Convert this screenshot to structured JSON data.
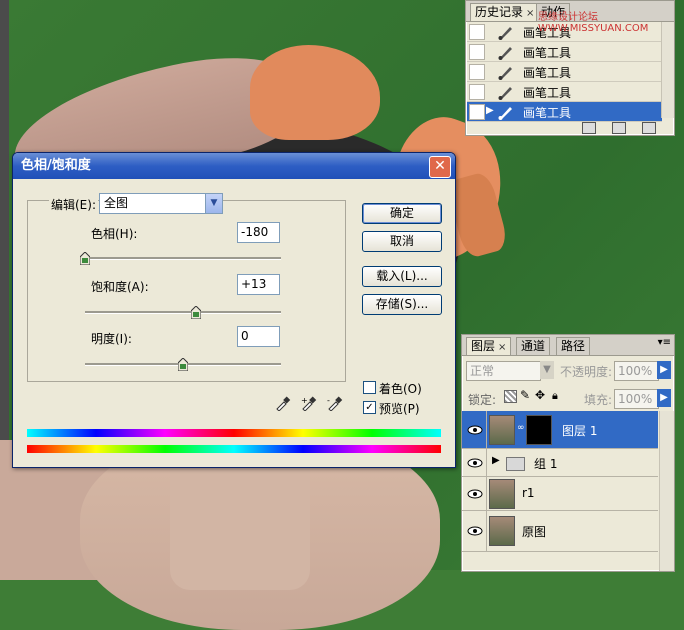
{
  "history": {
    "tabs": [
      "历史记录",
      "动作"
    ],
    "watermark": "思缘设计论坛 WWW.MISSYUAN.COM",
    "items": [
      {
        "label": "画笔工具",
        "selected": false
      },
      {
        "label": "画笔工具",
        "selected": false
      },
      {
        "label": "画笔工具",
        "selected": false
      },
      {
        "label": "画笔工具",
        "selected": false
      },
      {
        "label": "画笔工具",
        "selected": true
      }
    ]
  },
  "dialog": {
    "title": "色相/饱和度",
    "edit_label": "编辑(E):",
    "edit_value": "全图",
    "hue_label": "色相(H):",
    "hue_value": "-180",
    "sat_label": "饱和度(A):",
    "sat_value": "+13",
    "light_label": "明度(I):",
    "light_value": "0",
    "ok": "确定",
    "cancel": "取消",
    "load": "载入(L)...",
    "save": "存储(S)...",
    "colorize_label": "着色(O)",
    "colorize_checked": false,
    "preview_label": "预览(P)",
    "preview_checked": true,
    "hue_fraction": 0.0,
    "sat_fraction": 0.565,
    "light_fraction": 0.5,
    "close_glyph": "✕"
  },
  "layers": {
    "tabs": [
      "图层",
      "通道",
      "路径"
    ],
    "blend_mode": "正常",
    "opacity_label": "不透明度:",
    "opacity_value": "100%",
    "lock_label": "锁定:",
    "fill_label": "填充:",
    "fill_value": "100%",
    "rows": [
      {
        "name": "图层 1",
        "selected": true
      },
      {
        "name": "组 1",
        "selected": false
      },
      {
        "name": "r1",
        "selected": false
      },
      {
        "name": "原图",
        "selected": false
      }
    ]
  },
  "colors": {
    "selection": "#316ac5",
    "background_green": "#3e7d36"
  }
}
